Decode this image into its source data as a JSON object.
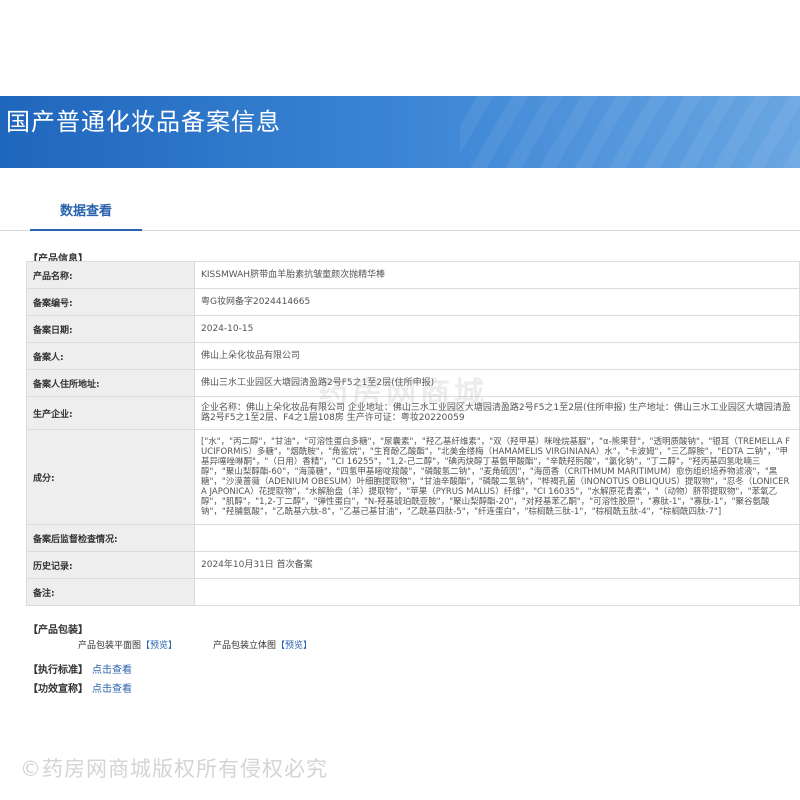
{
  "header": {
    "title": "国产普通化妆品备案信息"
  },
  "tabs": [
    {
      "label": "数据查看"
    }
  ],
  "product_info": {
    "section_title": "【产品信息】",
    "rows": [
      {
        "label": "产品名称:",
        "value": "KISSMWAH脐带血羊胎素抗皱童颜次抛精华棒"
      },
      {
        "label": "备案编号:",
        "value": "粤G妆网备字2024414665"
      },
      {
        "label": "备案日期:",
        "value": "2024-10-15"
      },
      {
        "label": "备案人:",
        "value": "佛山上朵化妆品有限公司"
      },
      {
        "label": "备案人住所地址:",
        "value": "佛山三水工业园区大塘园清盈路2号F5之1至2层(住所申报)"
      },
      {
        "label": "生产企业:",
        "value": "企业名称：佛山上朵化妆品有限公司 企业地址：佛山三水工业园区大塘园清盈路2号F5之1至2层(住所申报) 生产地址：佛山三水工业园区大塘园清盈路2号F5之1至2层、F4之1层108房 生产许可证：粤妆20220059"
      },
      {
        "label": "成分:",
        "value": "[\"水\"，\"丙二醇\"，\"甘油\"，\"可溶性蛋白多糖\"，\"尿囊素\"，\"羟乙基纤维素\"，\"双（羟甲基）咪唑烷基脲\"，\"α-熊果苷\"，\"透明质酸钠\"，\"银耳（TREMELLA FUCIFORMIS）多糖\"，\"烟酰胺\"，\"角鲨烷\"，\"生育酚乙酸酯\"，\"北美金缕梅（HAMAMELIS VIRGINIANA）水\"，\"卡波姆\"，\"三乙醇胺\"，\"EDTA 二钠\"，\"甲基异噻唑啉酮\"，\"（日用）香精\"，\"CI 16255\"，\"1,2-己二醇\"，\"碘丙炔醇丁基氨甲酸酯\"，\"辛酰羟肟酸\"，\"氯化钠\"，\"丁二醇\"，\"羟丙基四氢吡喃三醇\"，\"聚山梨醇酯-60\"，\"海藻糖\"，\"四氢甲基嘧啶羧酸\"，\"磷酸氢二钠\"，\"麦角硫因\"，\"海茴香（CRITHMUM MARITIMUM）愈伤组织培养物滤液\"，\"黑糖\"，\"沙漠蔷薇（ADENIUM OBESUM）叶细胞提取物\"，\"甘油辛酸酯\"，\"磷酸二氢钠\"，\"桦褐孔菌（INONOTUS OBLIQUUS）提取物\"，\"忍冬（LONICERA JAPONICA）花提取物\"，\"水解胎盘（羊）提取物\"，\"苹果（PYRUS MALUS）纤维\"，\"CI 16035\"，\"水解原花青素\"，\"（动物）脐带提取物\"，\"苯氧乙醇\"，\"肌醇\"，\"1,2-丁二醇\"，\"弹性蛋白\"，\"N-羟基琥珀酰亚胺\"，\"聚山梨醇酯-20\"，\"对羟基苯乙酮\"，\"可溶性胶原\"，\"寡肽-1\"，\"寡肽-1\"，\"聚谷氨酸钠\"，\"羟脯氨酸\"，\"乙酰基六肽-8\"，\"乙基己基甘油\"，\"乙酰基四肽-5\"，\"纤连蛋白\"，\"棕榈酰三肽-1\"，\"棕榈酰五肽-4\"，\"棕榈酰四肽-7\"]"
      },
      {
        "label": "备案后监督检查情况:",
        "value": ""
      },
      {
        "label": "历史记录:",
        "value": "2024年10月31日 首次备案"
      },
      {
        "label": "备注:",
        "value": ""
      }
    ]
  },
  "packaging": {
    "section_title": "【产品包装】",
    "flat_label": "产品包装平面图",
    "flat_link": "【预览】",
    "stereo_label": "产品包装立体图",
    "stereo_link": "【预览】"
  },
  "standard": {
    "label": "【执行标准】",
    "link": "点击查看"
  },
  "efficacy": {
    "label": "【功效宣称】",
    "link": "点击查看"
  },
  "watermarks": {
    "center": "药房网商城",
    "bottom": "©药房网商城版权所有侵权必究"
  }
}
